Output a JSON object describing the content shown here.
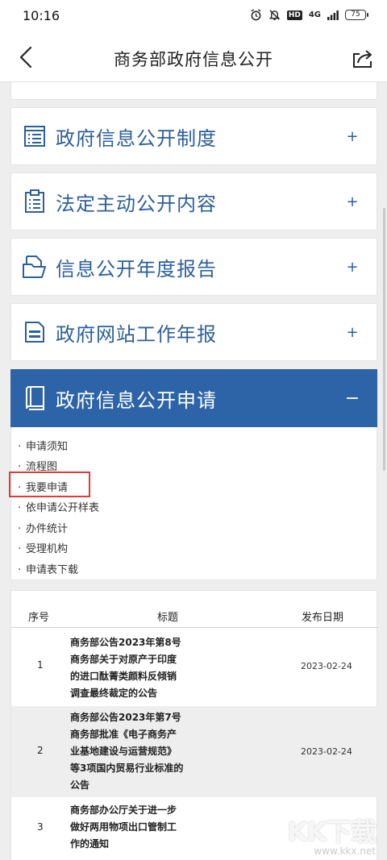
{
  "status_bar": {
    "time": "10:16",
    "network": "4G",
    "hd": "HD",
    "battery": "75"
  },
  "header": {
    "title": "商务部政府信息公开"
  },
  "sections": [
    {
      "label": "政府信息公开制度",
      "toggle": "+",
      "icon": "list-document-icon"
    },
    {
      "label": "法定主动公开内容",
      "toggle": "+",
      "icon": "clipboard-icon"
    },
    {
      "label": "信息公开年度报告",
      "toggle": "+",
      "icon": "folder-icon"
    },
    {
      "label": "政府网站工作年报",
      "toggle": "+",
      "icon": "report-icon"
    },
    {
      "label": "政府信息公开申请",
      "toggle": "−",
      "icon": "book-icon",
      "active": true
    }
  ],
  "sub_items": [
    "申请须知",
    "流程图",
    "我要申请",
    "依申请公开样表",
    "办件统计",
    "受理机构",
    "申请表下载"
  ],
  "table": {
    "headers": {
      "no": "序号",
      "title": "标题",
      "date": "发布日期"
    },
    "rows": [
      {
        "no": "1",
        "title": "商务部公告2023年第8号 商务部关于对原产于印度的进口酞菁类颜料反倾销调查最终裁定的公告",
        "lines": [
          "商务部公告2023年第8号",
          "商务部关于对原产于印度",
          "的进口酞菁类颜料反倾销",
          "调查最终裁定的公告"
        ],
        "date": "2023-02-24"
      },
      {
        "no": "2",
        "title": "商务部公告2023年第7号 商务部批准《电子商务产业基地建设与运营规范》等3项国内贸易行业标准的公告",
        "lines": [
          "商务部公告2023年第7号",
          "商务部批准《电子商务产",
          "业基地建设与运营规范》",
          "等3项国内贸易行业标准的",
          "公告"
        ],
        "date": "2023-02-24"
      },
      {
        "no": "3",
        "title": "商务部办公厅关于进一步做好两用物项出口管制工作的通知",
        "lines": [
          "商务部办公厅关于进一步",
          "做好两用物项出口管制工",
          "作的通知"
        ],
        "date": ""
      }
    ]
  },
  "watermark": {
    "mark": "KK下载",
    "url": "www.kkx.net"
  }
}
